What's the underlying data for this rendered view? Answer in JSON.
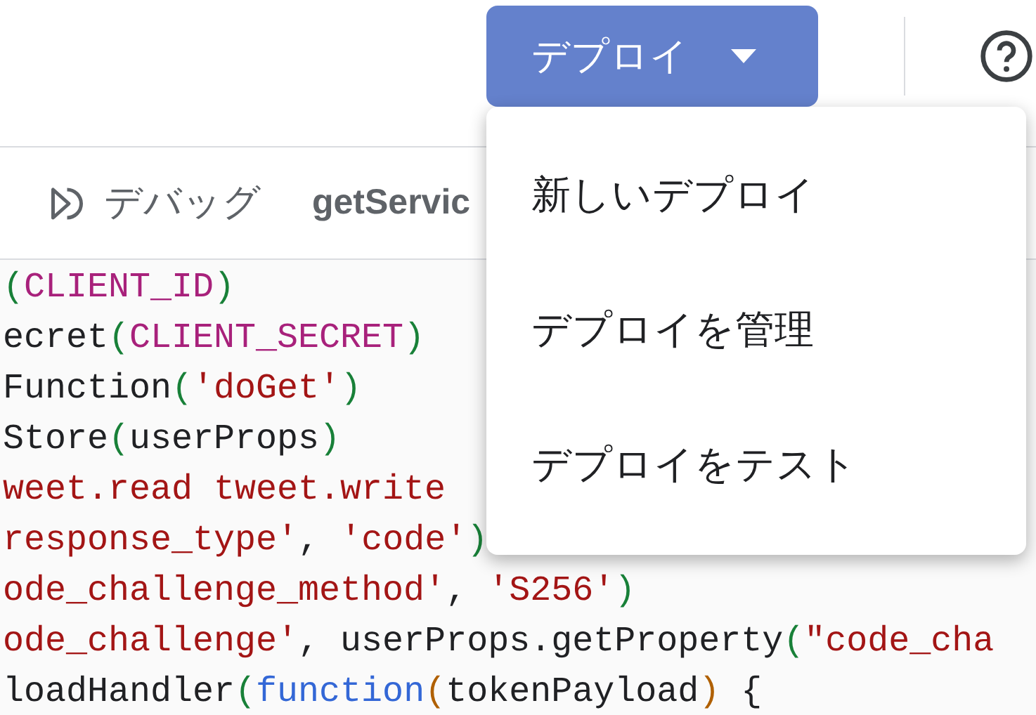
{
  "header": {
    "deploy_button": {
      "label": "デプロイ"
    }
  },
  "toolbar": {
    "debug_button": {
      "label": "デバッグ"
    },
    "function_select": {
      "value": "getServic"
    }
  },
  "code_lines": [
    {
      "tokens": [
        {
          "kind": "paren",
          "text": "("
        },
        {
          "kind": "constant",
          "text": "CLIENT_ID"
        },
        {
          "kind": "paren",
          "text": ")"
        }
      ]
    },
    {
      "tokens": [
        {
          "kind": "plain",
          "text": "ecret"
        },
        {
          "kind": "paren",
          "text": "("
        },
        {
          "kind": "constant",
          "text": "CLIENT_SECRET"
        },
        {
          "kind": "paren",
          "text": ")"
        }
      ]
    },
    {
      "tokens": [
        {
          "kind": "plain",
          "text": "Function"
        },
        {
          "kind": "paren",
          "text": "("
        },
        {
          "kind": "string",
          "text": "'doGet'"
        },
        {
          "kind": "paren",
          "text": ")"
        }
      ]
    },
    {
      "tokens": [
        {
          "kind": "plain",
          "text": "Store"
        },
        {
          "kind": "paren",
          "text": "("
        },
        {
          "kind": "plain",
          "text": "userProps"
        },
        {
          "kind": "paren",
          "text": ")"
        }
      ]
    },
    {
      "tokens": [
        {
          "kind": "string",
          "text": "weet.read tweet.write"
        }
      ]
    },
    {
      "tokens": [
        {
          "kind": "string",
          "text": "response_type'"
        },
        {
          "kind": "plain",
          "text": ", "
        },
        {
          "kind": "string",
          "text": "'code'"
        },
        {
          "kind": "paren",
          "text": ")"
        }
      ]
    },
    {
      "tokens": [
        {
          "kind": "string",
          "text": "ode_challenge_method'"
        },
        {
          "kind": "plain",
          "text": ", "
        },
        {
          "kind": "string",
          "text": "'S256'"
        },
        {
          "kind": "paren",
          "text": ")"
        }
      ]
    },
    {
      "tokens": [
        {
          "kind": "string",
          "text": "ode_challenge'"
        },
        {
          "kind": "plain",
          "text": ", userProps.getProperty"
        },
        {
          "kind": "paren",
          "text": "("
        },
        {
          "kind": "string",
          "text": "\"code_cha"
        }
      ]
    },
    {
      "tokens": [
        {
          "kind": "plain",
          "text": "loadHandler"
        },
        {
          "kind": "paren",
          "text": "("
        },
        {
          "kind": "keyword",
          "text": "function"
        },
        {
          "kind": "bracket",
          "text": "("
        },
        {
          "kind": "plain",
          "text": "tokenPayload"
        },
        {
          "kind": "bracket",
          "text": ")"
        },
        {
          "kind": "plain",
          "text": " {"
        }
      ]
    }
  ],
  "deploy_menu": {
    "items": [
      {
        "label": "新しいデプロイ"
      },
      {
        "label": "デプロイを管理"
      },
      {
        "label": "デプロイをテスト"
      }
    ]
  }
}
